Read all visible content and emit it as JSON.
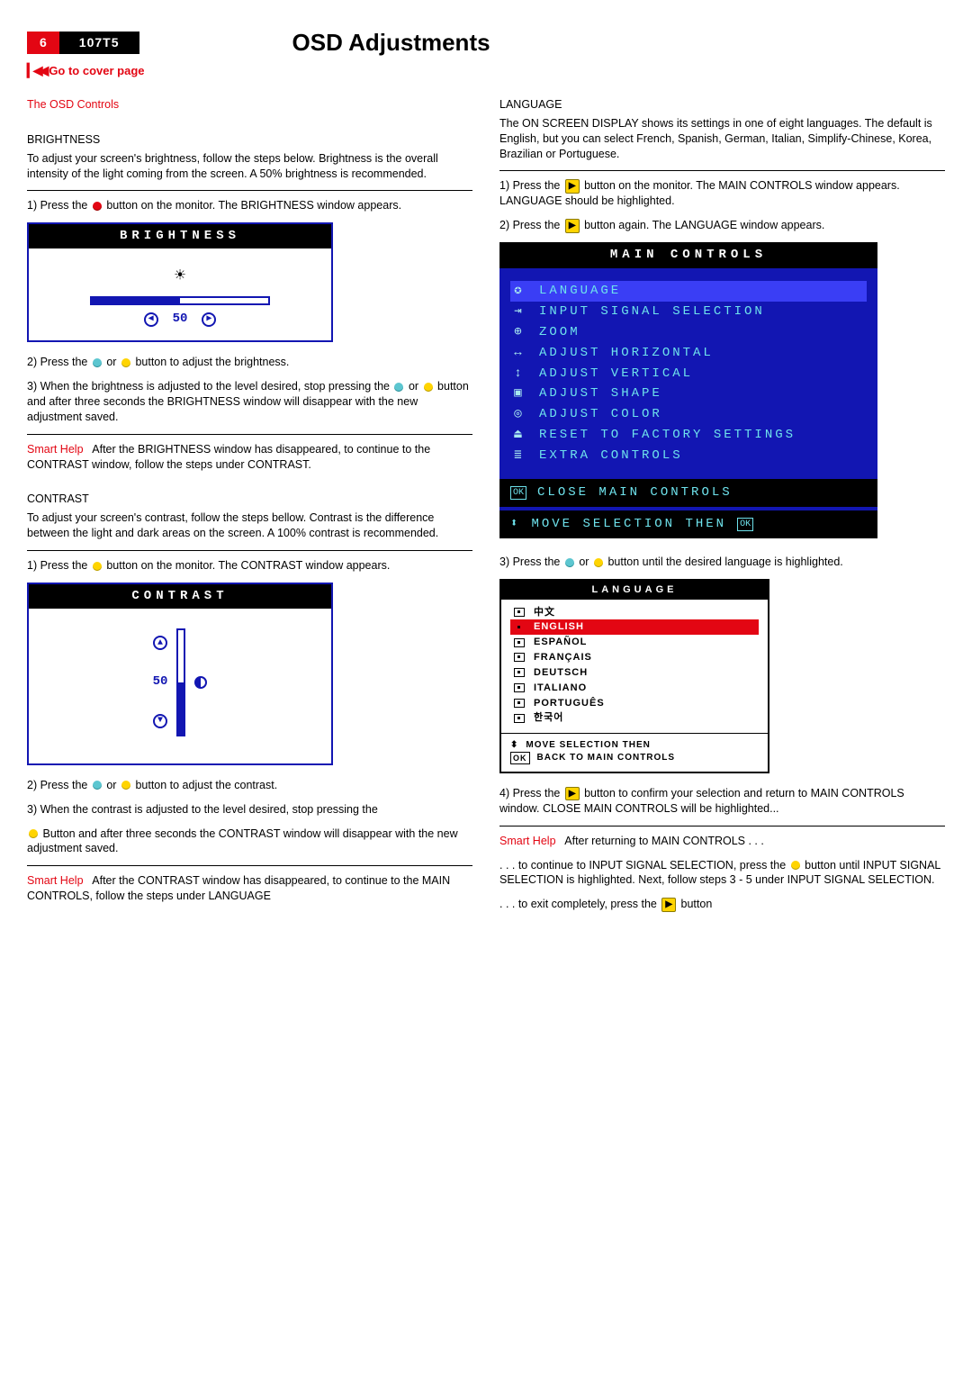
{
  "header": {
    "page_number": "6",
    "model": "107T5",
    "title": "OSD Adjustments",
    "cover_link": "Go to cover page"
  },
  "left": {
    "controls_heading": "The OSD Controls",
    "brightness": {
      "heading": "BRIGHTNESS",
      "intro": "To adjust your screen's brightness, follow the steps below. Brightness is the overall intensity of the light coming from the screen. A 50% brightness is recommended.",
      "step1a": "1) Press the ",
      "step1b": " button on the monitor. The BRIGHTNESS window appears.",
      "panel_title": "BRIGHTNESS",
      "panel_value": "50",
      "step2a": "2) Press the ",
      "step2b": " or ",
      "step2c": " button to adjust the brightness.",
      "step3a": "3) When the brightness is adjusted to the level desired, stop pressing the ",
      "step3b": " or ",
      "step3c": " button and after three seconds the BRIGHTNESS window will disappear with the new adjustment saved.",
      "smart_label": "Smart Help",
      "smart_text": "After the BRIGHTNESS window has disappeared, to continue to the CONTRAST window, follow the steps under CONTRAST."
    },
    "contrast": {
      "heading": "CONTRAST",
      "intro": "To adjust your screen's contrast, follow the steps bellow. Contrast is the difference between the light and dark areas on the screen. A 100% contrast is recommended.",
      "step1a": "1) Press the ",
      "step1b": " button on the monitor. The CONTRAST window appears.",
      "panel_title": "CONTRAST",
      "panel_value": "50",
      "step2a": "2) Press the ",
      "step2b": " or ",
      "step2c": " button to adjust the contrast.",
      "step3": "3) When the contrast is adjusted to the level desired, stop pressing the",
      "step3b": " Button and after three seconds the CONTRAST window will disappear with the new adjustment saved.",
      "smart_label": "Smart Help",
      "smart_text": "After the CONTRAST window has disappeared, to continue to the MAIN CONTROLS, follow the steps under LANGUAGE"
    }
  },
  "right": {
    "language": {
      "heading": "LANGUAGE",
      "intro": "The ON SCREEN DISPLAY shows its settings in one of eight languages. The default is English, but you can select French, Spanish, German, Italian, Simplify-Chinese, Korea,  Brazilian or Portuguese.",
      "step1a": "1) Press the ",
      "step1b": " button on the monitor. The MAIN CONTROLS window appears. LANGUAGE should be highlighted.",
      "step2a": "2) Press the ",
      "step2b": " button again. The LANGUAGE window appears.",
      "main_title": "MAIN CONTROLS",
      "items": [
        "LANGUAGE",
        "INPUT SIGNAL SELECTION",
        "ZOOM",
        "ADJUST HORIZONTAL",
        "ADJUST VERTICAL",
        "ADJUST SHAPE",
        "ADJUST COLOR",
        "RESET TO FACTORY SETTINGS",
        "EXTRA CONTROLS"
      ],
      "close_row": "CLOSE MAIN CONTROLS",
      "move_row": "MOVE SELECTION THEN",
      "step3a": "3) Press the ",
      "step3b": " or ",
      "step3c": " button until the desired language is highlighted.",
      "lang_title": "LANGUAGE",
      "langs": [
        "中文",
        "ENGLISH",
        "ESPAÑOL",
        "FRANÇAIS",
        "DEUTSCH",
        "ITALIANO",
        "PORTUGUÊS",
        "한국어"
      ],
      "lang_foot1": "MOVE SELECTION THEN",
      "lang_foot2": "BACK TO MAIN CONTROLS",
      "step4a": "4) Press the ",
      "step4b": " button to confirm your selection and return to MAIN CONTROLS window. CLOSE MAIN CONTROLS will be highlighted...",
      "smart_label": "Smart Help",
      "smart_text": "After returning to MAIN CONTROLS . . .",
      "cont1a": ". . . to continue to INPUT SIGNAL SELECTION, press the ",
      "cont1b": " button until INPUT SIGNAL SELECTION is highlighted. Next, follow steps 3 - 5 under INPUT SIGNAL SELECTION.",
      "cont2a": ". . . to exit completely, press the ",
      "cont2b": " button"
    }
  }
}
